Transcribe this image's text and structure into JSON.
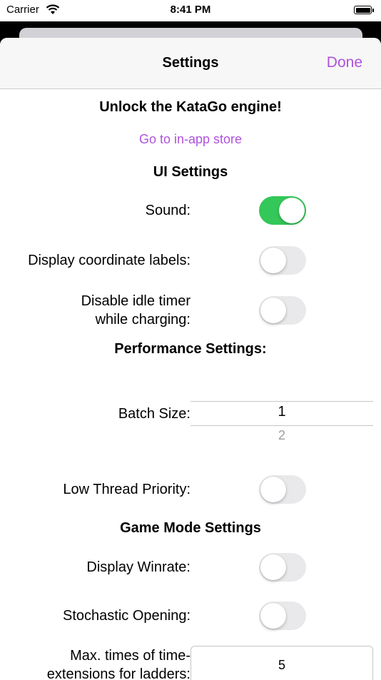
{
  "status_bar": {
    "carrier": "Carrier",
    "time": "8:41 PM",
    "icons": [
      "wifi-icon",
      "battery-icon"
    ]
  },
  "nav": {
    "title": "Settings",
    "done_label": "Done"
  },
  "colors": {
    "accent": "#af52de",
    "toggle_on": "#34c759",
    "toggle_off": "#e9e9eb"
  },
  "unlock": {
    "heading": "Unlock the KataGo engine!",
    "store_link": "Go to in-app store"
  },
  "ui_settings": {
    "heading": "UI Settings",
    "sound": {
      "label": "Sound:",
      "on": true
    },
    "coordinates": {
      "label": "Display coordinate labels:",
      "on": false
    },
    "idle_timer": {
      "label_line1": "Disable idle timer",
      "label_line2": "while charging:",
      "on": false
    }
  },
  "performance": {
    "heading": "Performance Settings:",
    "batch_size": {
      "label": "Batch Size:",
      "selected": "1",
      "next": "2"
    },
    "low_thread_priority": {
      "label": "Low Thread Priority:",
      "on": false
    }
  },
  "game_mode": {
    "heading": "Game Mode Settings",
    "display_winrate": {
      "label": "Display Winrate:",
      "on": false
    },
    "stochastic_opening": {
      "label": "Stochastic Opening:",
      "on": false
    },
    "time_extensions": {
      "label_line1": "Max. times of time-",
      "label_line2": "extensions for ladders:",
      "value": "5"
    }
  }
}
